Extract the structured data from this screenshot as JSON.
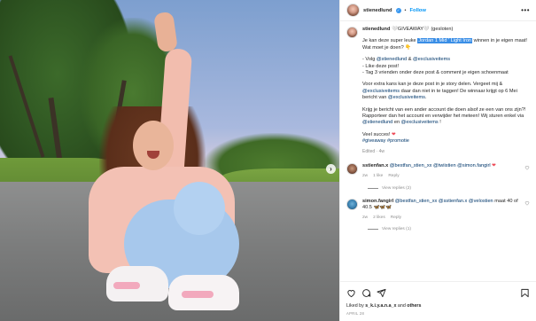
{
  "header": {
    "username": "stienedlund",
    "verified_glyph": "✓",
    "separator": "•",
    "follow_label": "Follow",
    "more_glyph": "•••"
  },
  "caption": {
    "username": "stienedlund",
    "title_pre": "🤍GIVEAWAY🤍 (gesloten)",
    "line1_pre": "Je kan deze super leuke ",
    "line1_highlight": "Jordan 1 Mid ' Light Iron",
    "line1_post": " winnen in je eigen maat! Wat moet je doen?",
    "line1_emoji": "👇",
    "step1_pre": "- Volg ",
    "step1_tag1": "@stienedlund",
    "step1_and": " & ",
    "step1_tag2": "@exclusiveitems",
    "step2": "- Like deze post!",
    "step3": "- Tag 3 vrienden onder deze post & comment je eigen schoenmaat",
    "extra_pre": "Voor extra kans kan je deze post in je story delen. Vergeet mij & ",
    "extra_tag1": "@exclusiveitems",
    "extra_mid": " daar dan niet in te taggen! De winnaar krijgt op 6 Mei bericht van ",
    "extra_tag2": "@exclusiveitems",
    "extra_end": ".",
    "warn_pre": "Krijg je bericht van een ander account die doen alsof ze een van ons zijn?! Rapporteer dan het account en verwijder het meteen! Wij sturen enkel via ",
    "warn_tag1": "@stienedlund",
    "warn_and": " en ",
    "warn_tag2": "@exclusiveitems",
    "warn_end": " !",
    "luck": "Veel succes!",
    "luck_emoji": "❤",
    "hashtags": "#giveaway #promotie",
    "meta": "Edited · 4w"
  },
  "comments": [
    {
      "username": "sstienfan.x",
      "text_pre": " ",
      "tag1": "@bestfan_stien_xx",
      "tag2": "@twiistien",
      "tag3": "@simon.fangirl",
      "emoji": "❤",
      "time": "2w",
      "likes": "1 like",
      "reply": "Reply",
      "view_replies": "View replies (2)"
    },
    {
      "username": "simon.fangirl",
      "text_pre": " ",
      "tag1": "@bestfan_stien_xx",
      "tag2": "@sstienfan.x",
      "tag3": "@velostien",
      "text_post": " maat 40 of 40.5",
      "emoji": "🦋🦋🦋",
      "time": "2w",
      "likes": "2 likes",
      "reply": "Reply",
      "view_replies": "View replies (1)"
    }
  ],
  "footer": {
    "liked_pre": "Liked by ",
    "liked_user": "s_k.i.y.a.n.a_x",
    "liked_and": " and ",
    "liked_others": "others",
    "date": "APRIL 28"
  },
  "icons": {
    "heart": "heart-icon",
    "comment": "comment-icon",
    "share": "share-icon",
    "save": "bookmark-icon",
    "next": "chevron-right-icon",
    "next_glyph": "›"
  },
  "colors": {
    "link": "#00376b",
    "follow": "#0095f6",
    "highlight": "#3a8ee6",
    "heart": "#ed4956"
  }
}
